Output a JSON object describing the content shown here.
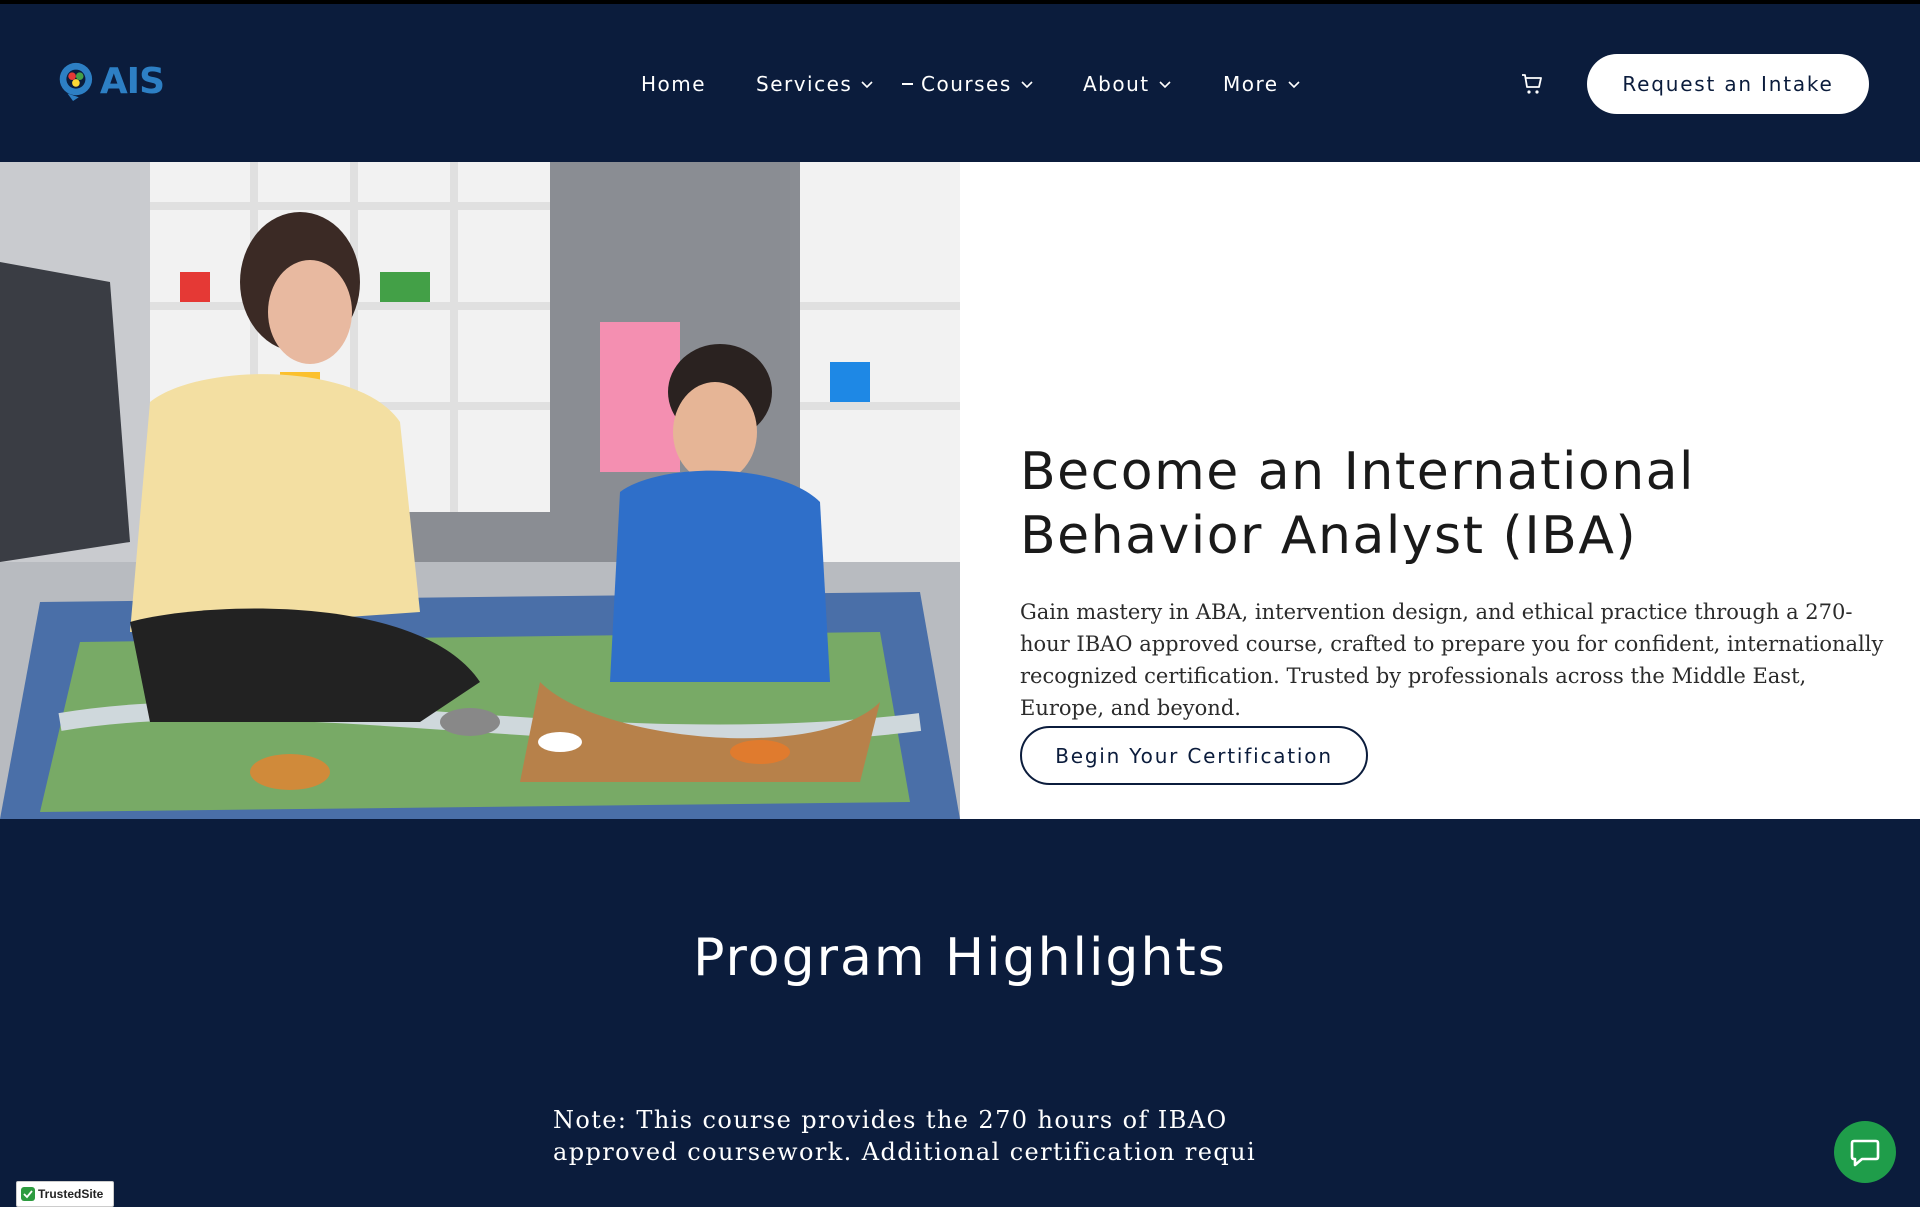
{
  "brand": {
    "logo_text": "AIS",
    "logo_icon": "brain-head-logo-icon"
  },
  "nav": {
    "items": [
      {
        "label": "Home",
        "has_dropdown": false
      },
      {
        "label": "Services",
        "has_dropdown": true
      },
      {
        "label": "Courses",
        "has_dropdown": true,
        "active": true
      },
      {
        "label": "About",
        "has_dropdown": true
      },
      {
        "label": "More",
        "has_dropdown": true
      }
    ],
    "cart_icon": "cart-icon",
    "cta_label": "Request an Intake"
  },
  "hero": {
    "image_description_icon": "therapist-child-photo",
    "title": "Become an International Behavior Analyst (IBA)",
    "body": "Gain mastery in ABA, intervention design, and ethical practice through a 270-hour IBAO approved course, crafted to prepare you for confident, internationally recognized certification. Trusted by professionals across the Middle East, Europe, and beyond.",
    "button_label": "Begin Your Certification"
  },
  "highlights": {
    "title": "Program Highlights",
    "note_line1": "Note: This course provides the 270 hours of IBAO",
    "note_line2": "approved coursework. Additional certification requi"
  },
  "widgets": {
    "chat_icon": "chat-bubble-icon",
    "trusted_label": "TrustedSite"
  },
  "colors": {
    "navy": "#0b1c3c",
    "white": "#ffffff",
    "brand_blue": "#2d7fc4",
    "chat_green": "#1f9d4a"
  }
}
